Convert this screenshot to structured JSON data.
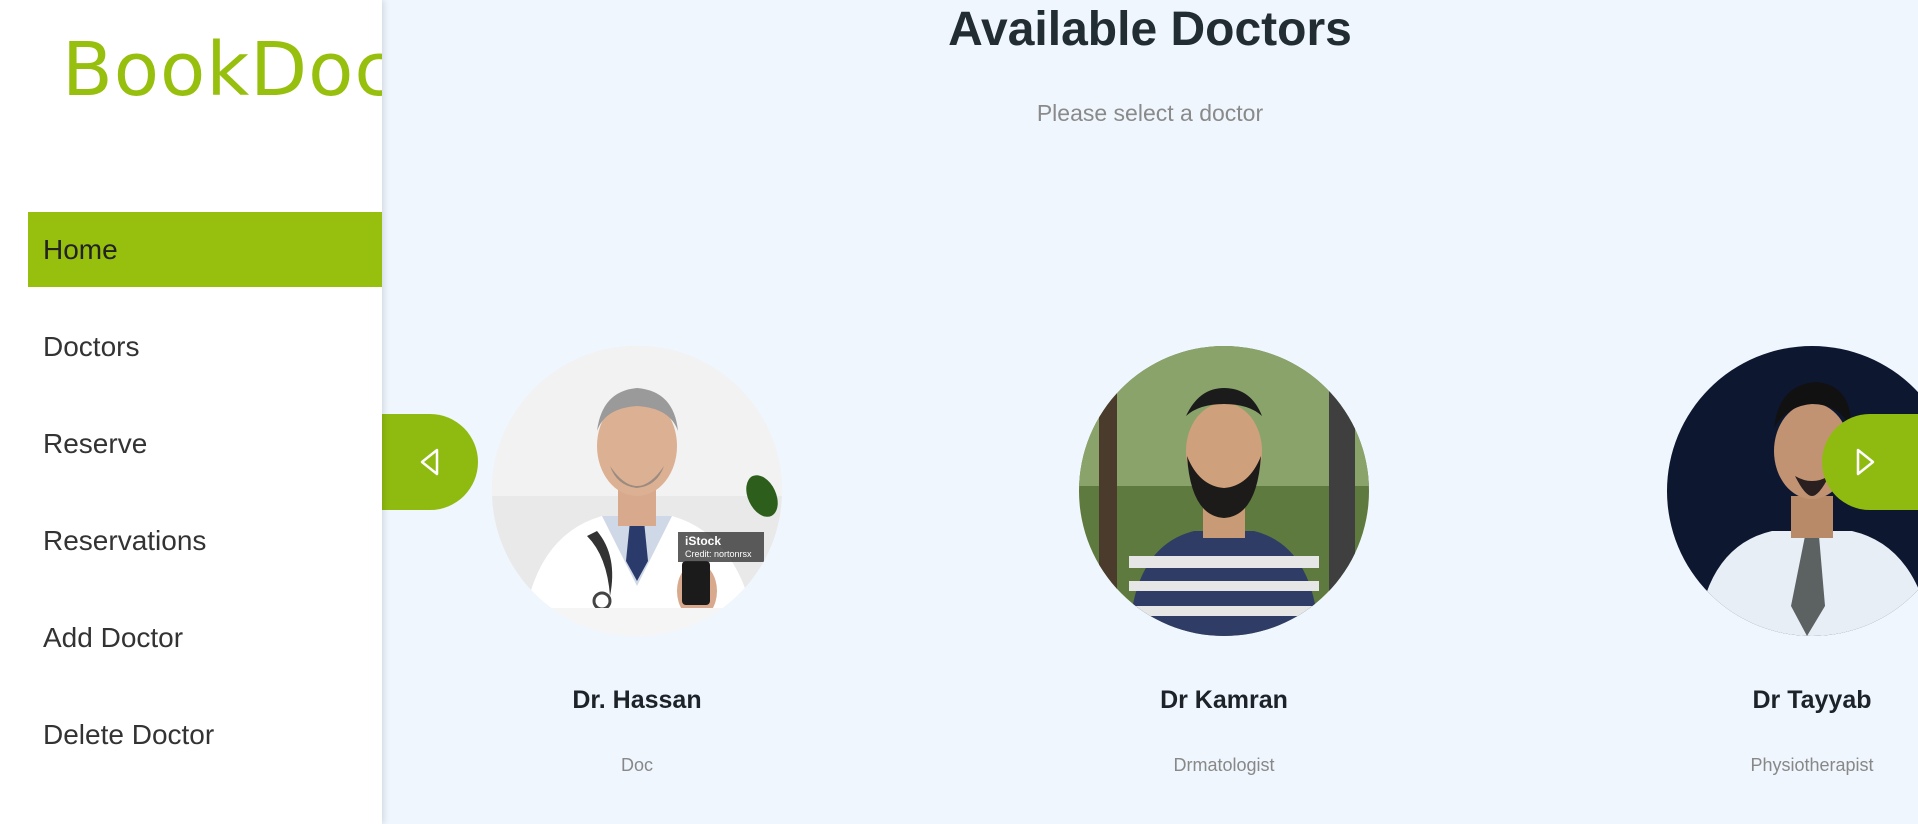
{
  "app": {
    "logo": "BookDoc"
  },
  "sidebar": {
    "items": [
      {
        "label": "Home",
        "active": true
      },
      {
        "label": "Doctors",
        "active": false
      },
      {
        "label": "Reserve",
        "active": false
      },
      {
        "label": "Reservations",
        "active": false
      },
      {
        "label": "Add Doctor",
        "active": false
      },
      {
        "label": "Delete Doctor",
        "active": false
      }
    ]
  },
  "main": {
    "title": "Available Doctors",
    "subtitle": "Please select a doctor",
    "doctors": [
      {
        "name": "Dr. Hassan",
        "specialty": "Doc",
        "photo_watermark": "iStock",
        "photo_credit": "Credit: nortonrsx"
      },
      {
        "name": "Dr Kamran",
        "specialty": "Drmatologist"
      },
      {
        "name": "Dr Tayyab",
        "specialty": "Physiotherapist"
      }
    ]
  },
  "icons": {
    "prev": "triangle-left-icon",
    "next": "triangle-right-icon"
  },
  "colors": {
    "accent": "#97bf0d",
    "background": "#eff6fd",
    "sidebar": "#ffffff"
  }
}
